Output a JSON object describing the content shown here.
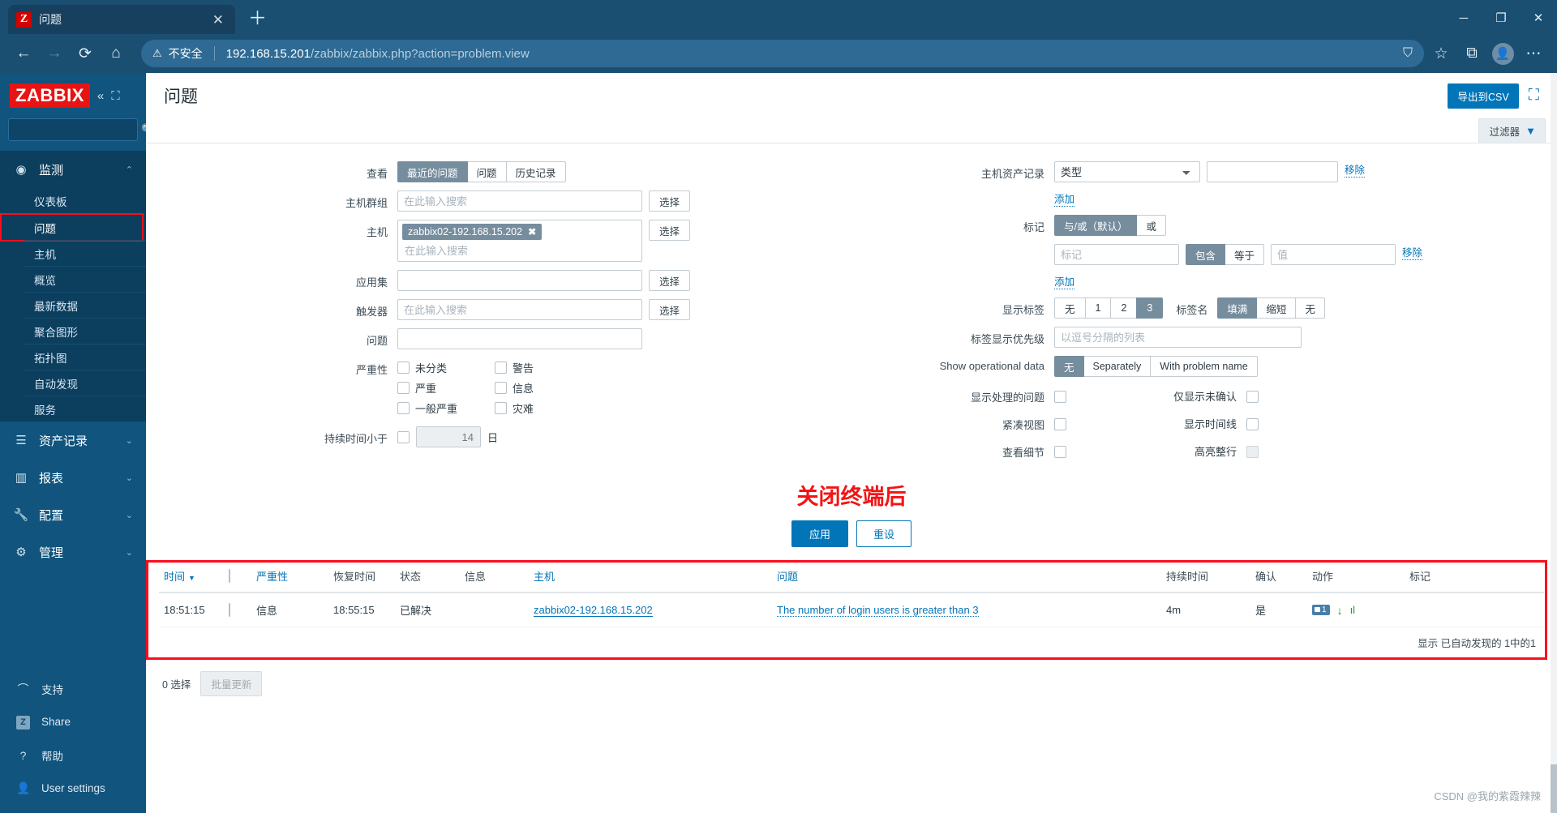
{
  "browser": {
    "tab": {
      "favicon_letter": "Z",
      "title": "问题",
      "close_icon": "✕"
    },
    "newtab_icon": "＋",
    "window_controls": {
      "minimize": "─",
      "maximize": "❐",
      "close": "✕"
    },
    "nav": {
      "back": "←",
      "forward": "→",
      "reload": "⟳",
      "home": "⌂"
    },
    "omnibox": {
      "warning_icon": "⚠",
      "security_label": "不安全",
      "url_host": "192.168.15.201",
      "url_path": "/zabbix/zabbix.php?action=problem.view"
    },
    "omni_icons": {
      "collections": "⛉",
      "favorite": "☆",
      "tabs": "⧉",
      "more": "⋯"
    }
  },
  "sidebar": {
    "logo": "ZABBIX",
    "collapse_icon": "«",
    "expand_icon": "⛶",
    "search_placeholder": "",
    "search_icon": "🔍",
    "sections": [
      {
        "label": "监测",
        "icon": "eye-icon",
        "icon_glyph": "◉",
        "expanded": true,
        "chevron": "⌃",
        "items": [
          {
            "label": "仪表板",
            "active": false
          },
          {
            "label": "问题",
            "active": true
          },
          {
            "label": "主机",
            "active": false
          },
          {
            "label": "概览",
            "active": false
          },
          {
            "label": "最新数据",
            "active": false
          },
          {
            "label": "聚合图形",
            "active": false
          },
          {
            "label": "拓扑图",
            "active": false
          },
          {
            "label": "自动发现",
            "active": false
          },
          {
            "label": "服务",
            "active": false
          }
        ]
      },
      {
        "label": "资产记录",
        "icon": "list-icon",
        "icon_glyph": "☰",
        "expanded": false,
        "chevron": "⌄",
        "items": []
      },
      {
        "label": "报表",
        "icon": "chart-icon",
        "icon_glyph": "▥",
        "expanded": false,
        "chevron": "⌄",
        "items": []
      },
      {
        "label": "配置",
        "icon": "wrench-icon",
        "icon_glyph": "🔧",
        "expanded": false,
        "chevron": "⌄",
        "items": []
      },
      {
        "label": "管理",
        "icon": "gear-icon",
        "icon_glyph": "⚙",
        "expanded": false,
        "chevron": "⌄",
        "items": []
      }
    ],
    "footer": [
      {
        "label": "支持",
        "icon": "headset-icon",
        "icon_glyph": "◠"
      },
      {
        "label": "Share",
        "icon": "zabbix-square-icon",
        "icon_glyph": "Z"
      },
      {
        "label": "帮助",
        "icon": "question-icon",
        "icon_glyph": "?"
      },
      {
        "label": "User settings",
        "icon": "user-icon",
        "icon_glyph": "👤"
      }
    ]
  },
  "header": {
    "title": "问题",
    "export_csv": "导出到CSV",
    "kiosk_icon": "⛶"
  },
  "filter_tab": {
    "label": "过滤器",
    "icon": "funnel-icon",
    "glyph": "▼"
  },
  "filter": {
    "left": {
      "view_label": "查看",
      "view_options": [
        "最近的问题",
        "问题",
        "历史记录"
      ],
      "view_selected": "最近的问题",
      "hostgroup_label": "主机群组",
      "hostgroup_placeholder": "在此输入搜索",
      "hostgroup_select_btn": "选择",
      "host_label": "主机",
      "host_chip": "zabbix02-192.168.15.202",
      "host_chip_remove": "✖",
      "host_placeholder": "在此输入搜索",
      "host_select_btn": "选择",
      "appset_label": "应用集",
      "appset_value": "",
      "appset_select_btn": "选择",
      "trigger_label": "触发器",
      "trigger_placeholder": "在此输入搜索",
      "trigger_select_btn": "选择",
      "problem_label": "问题",
      "problem_value": "",
      "severity_label": "严重性",
      "severities": [
        {
          "label": "未分类",
          "checked": false
        },
        {
          "label": "警告",
          "checked": false
        },
        {
          "label": "严重",
          "checked": false
        },
        {
          "label": "信息",
          "checked": false
        },
        {
          "label": "一般严重",
          "checked": false
        },
        {
          "label": "灾难",
          "checked": false
        }
      ],
      "duration_label": "持续时间小于",
      "duration_checked": false,
      "duration_value": "14",
      "duration_unit": "日"
    },
    "right": {
      "host_record_label": "主机资产记录",
      "host_record_type": "类型",
      "host_record_value": "",
      "host_record_remove": "移除",
      "host_record_add": "添加",
      "tags_label": "标记",
      "tags_mode_options": [
        "与/或（默认）",
        "或"
      ],
      "tags_mode_selected": "与/或（默认）",
      "tag_name_placeholder": "标记",
      "tag_operator_options": [
        "包含",
        "等于"
      ],
      "tag_operator_selected": "包含",
      "tag_value_placeholder": "值",
      "tag_remove": "移除",
      "tag_add": "添加",
      "show_tags_label": "显示标签",
      "show_tags_options": [
        "无",
        "1",
        "2",
        "3"
      ],
      "show_tags_selected": "3",
      "tag_name_label": "标签名",
      "tag_name_options": [
        "填满",
        "缩短",
        "无"
      ],
      "tag_name_selected": "填满",
      "tag_priority_label": "标签显示优先级",
      "tag_priority_placeholder": "以逗号分隔的列表",
      "show_op_data_label": "Show operational data",
      "show_op_data_options": [
        "无",
        "Separately",
        "With problem name"
      ],
      "show_op_data_selected": "无",
      "checkboxes": [
        {
          "label": "显示处理的问题",
          "checked": false,
          "disabled": false
        },
        {
          "label": "仅显示未确认",
          "checked": false,
          "disabled": false
        },
        {
          "label": "紧凑视图",
          "checked": false,
          "disabled": false
        },
        {
          "label": "显示时间线",
          "checked": false,
          "disabled": false
        },
        {
          "label": "查看细节",
          "checked": false,
          "disabled": false
        },
        {
          "label": "高亮整行",
          "checked": false,
          "disabled": true
        }
      ]
    },
    "annotation": "关闭终端后",
    "apply_btn": "应用",
    "reset_btn": "重设"
  },
  "results": {
    "columns": [
      {
        "key": "time",
        "label": "时间",
        "sort_icon": "▼",
        "link": true
      },
      {
        "key": "checkbox",
        "label": "",
        "link": false
      },
      {
        "key": "severity",
        "label": "严重性",
        "link": true
      },
      {
        "key": "recovery_time",
        "label": "恢复时间",
        "link": false
      },
      {
        "key": "status",
        "label": "状态",
        "link": false
      },
      {
        "key": "info",
        "label": "信息",
        "link": false
      },
      {
        "key": "host",
        "label": "主机",
        "link": true
      },
      {
        "key": "problem",
        "label": "问题",
        "link": true
      },
      {
        "key": "duration",
        "label": "持续时间",
        "link": false
      },
      {
        "key": "ack",
        "label": "确认",
        "link": false
      },
      {
        "key": "actions",
        "label": "动作",
        "link": false
      },
      {
        "key": "tags",
        "label": "标记",
        "link": false
      }
    ],
    "rows": [
      {
        "time": "18:51:15",
        "severity": "信息",
        "recovery_time": "18:55:15",
        "status": "已解决",
        "info": "",
        "host": "zabbix02-192.168.15.202",
        "problem": "The number of login users is greater than 3",
        "duration": "4m",
        "ack": "是",
        "actions": {
          "message_count": "1",
          "message_icon": "message-icon",
          "down_arrow": "↓",
          "bars": "ıl"
        },
        "tags": ""
      }
    ],
    "display_note": "显示 已自动发现的 1中的1",
    "selected_count": "0 选择",
    "bulk_update_btn": "批量更新"
  },
  "watermark": "CSDN @我的紫霞辣辣"
}
